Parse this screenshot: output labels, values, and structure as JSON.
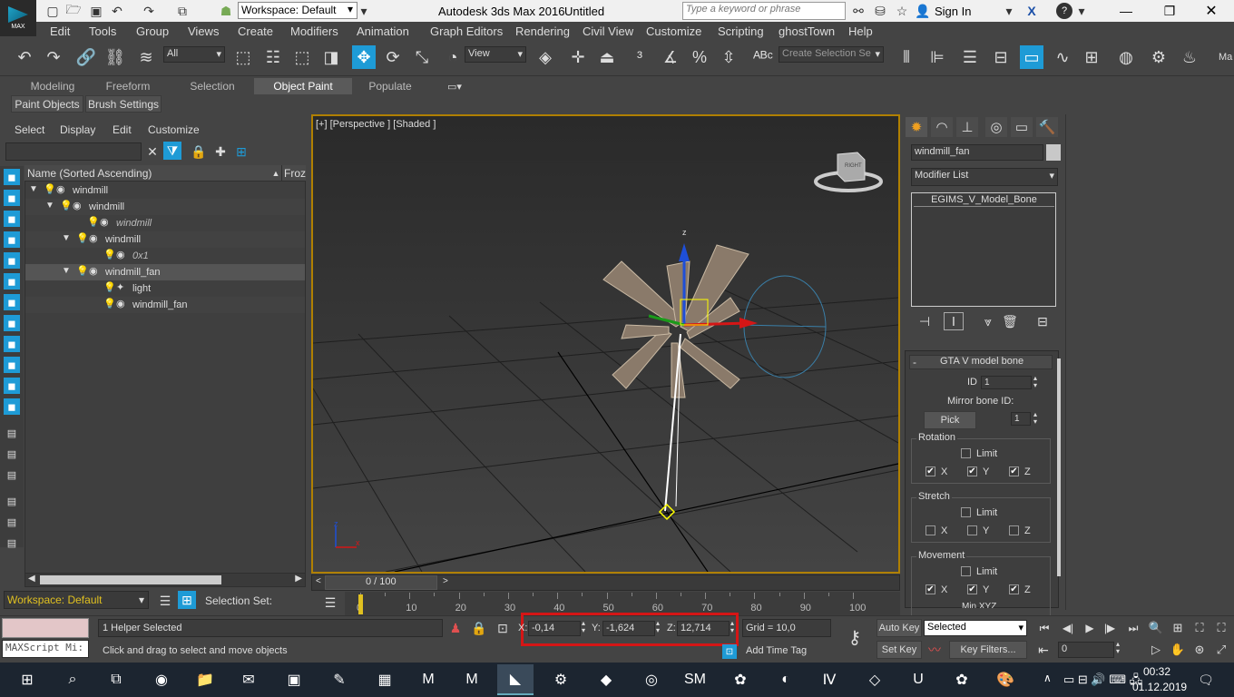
{
  "titlebar": {
    "workspace": "Workspace: Default",
    "title": "Autodesk 3ds Max 2016",
    "doc": "Untitled",
    "search_placeholder": "Type a keyword or phrase",
    "sign_in": "Sign In",
    "app_icon": "MAX"
  },
  "menu": [
    "Edit",
    "Tools",
    "Group",
    "Views",
    "Create",
    "Modifiers",
    "Animation",
    "Graph Editors",
    "Rendering",
    "Civil View",
    "Customize",
    "Scripting",
    "ghostTown",
    "Help"
  ],
  "toolbar": {
    "filter": "All",
    "refcoord": "View",
    "selection_set": "Create Selection Se",
    "right_label": "Ma"
  },
  "ribbon": {
    "tabs": [
      "Modeling",
      "Freeform",
      "Selection",
      "Object Paint",
      "Populate"
    ],
    "subtabs": [
      "Paint Objects",
      "Brush Settings"
    ]
  },
  "scene": {
    "menu": [
      "Select",
      "Display",
      "Edit",
      "Customize"
    ],
    "col_name": "Name (Sorted Ascending)",
    "col_frozen": "Froz",
    "rows": [
      {
        "name": "windmill"
      },
      {
        "name": "windmill"
      },
      {
        "name": "windmill"
      },
      {
        "name": "windmill"
      },
      {
        "name": "0x1"
      },
      {
        "name": "windmill_fan"
      },
      {
        "name": "light"
      },
      {
        "name": "windmill_fan"
      }
    ],
    "workspace": "Workspace: Default",
    "selection_set": "Selection Set:"
  },
  "viewport": {
    "label": "[+] [Perspective ] [Shaded ]",
    "cube_label": "RIGHT",
    "frame": "0 / 100",
    "ticks": [
      "0",
      "10",
      "20",
      "30",
      "40",
      "50",
      "60",
      "70",
      "80",
      "90",
      "100"
    ]
  },
  "cmd": {
    "object_name": "windmill_fan",
    "modifier_list": "Modifier List",
    "stack_item": "EGIMS_V_Model_Bone",
    "rollout": "GTA V model bone",
    "id_label": "ID",
    "id_value": "1",
    "mirror_label": "Mirror bone ID:",
    "pick": "Pick",
    "mirror_value": "1",
    "rotation": "Rotation",
    "stretch": "Stretch",
    "movement": "Movement",
    "limit": "Limit",
    "x": "X",
    "y": "Y",
    "z": "Z",
    "min": "Min XYZ",
    "check": "✔"
  },
  "status": {
    "maxscript": "MAXScript Mi:",
    "helper": "1 Helper Selected",
    "prompt": "Click and drag to select and move objects",
    "x_label": "X:",
    "x": "-0,14",
    "y_label": "Y:",
    "y": "-1,624",
    "z_label": "Z:",
    "z": "12,714",
    "grid": "Grid = 10,0",
    "add_time_tag": "Add Time Tag",
    "auto_key": "Auto Key",
    "selected": "Selected",
    "set_key": "Set Key",
    "key_filters": "Key Filters...",
    "frame": "0"
  },
  "taskbar": {
    "time": "00:32",
    "date": "01.12.2019"
  },
  "colors": {
    "accent": "#1e9bd6",
    "highlight": "#d51616",
    "viewport_bg": "#3c3c3c",
    "gold": "#b08000"
  }
}
